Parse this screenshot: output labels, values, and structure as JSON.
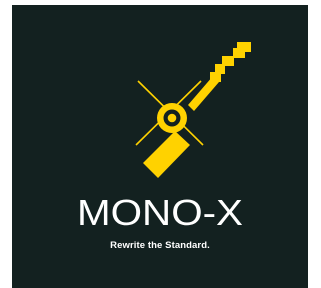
{
  "brand": {
    "name": "MONO-X",
    "tagline": "Rewrite the Standard."
  },
  "colors": {
    "background": "#132120",
    "accent": "#FFD200",
    "text": "#FFFFFF"
  },
  "icons": {
    "logo": "pixel-key-mark-icon"
  }
}
